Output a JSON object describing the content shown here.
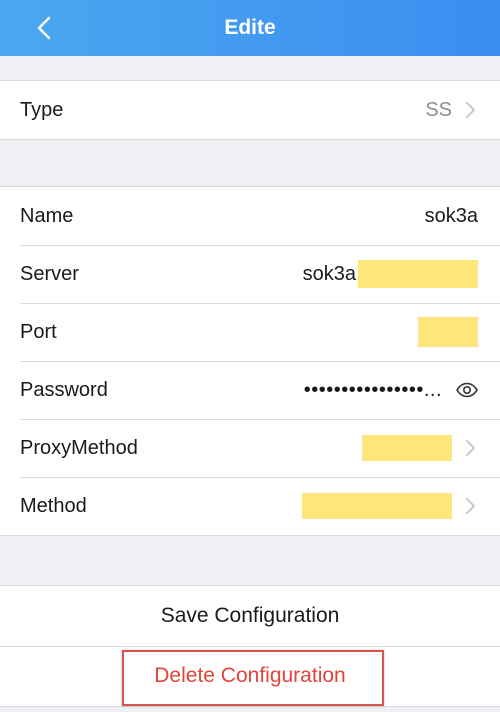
{
  "navbar": {
    "title": "Edite",
    "back_icon": "chevron-left-icon",
    "gradient_start": "#4aa8ef",
    "gradient_end": "#3b8df0"
  },
  "type_row": {
    "label": "Type",
    "value": "SS",
    "icon": "chevron-right-icon"
  },
  "fields": {
    "name": {
      "label": "Name",
      "value": "sok3a"
    },
    "server": {
      "label": "Server",
      "value": "sok3a"
    },
    "port": {
      "label": "Port"
    },
    "password": {
      "label": "Password",
      "value": "••••••••••••••••...",
      "icon": "eye-icon"
    },
    "proxy_method": {
      "label": "ProxyMethod",
      "icon": "chevron-right-icon"
    },
    "method": {
      "label": "Method",
      "icon": "chevron-right-icon"
    }
  },
  "actions": {
    "save_label": "Save Configuration",
    "delete_label": "Delete Configuration",
    "delete_color": "#e2443a",
    "highlight_border_color": "#d9534f"
  },
  "redaction_color": "#fde77a"
}
